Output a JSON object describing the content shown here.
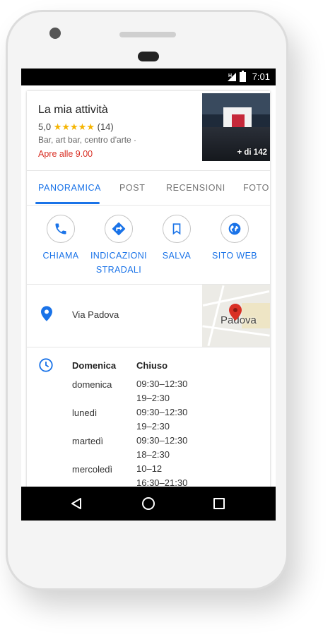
{
  "status_bar": {
    "time": "7:01",
    "network": "H"
  },
  "business": {
    "name": "La mia attività",
    "rating": "5,0",
    "stars": "★★★★★",
    "reviews_count": "(14)",
    "category": "Bar, art bar, centro d'arte  ·",
    "open_info": "Apre alle 9.00",
    "photos_more": "+ di 142"
  },
  "tabs": [
    "PANORAMICA",
    "POST",
    "RECENSIONI",
    "FOTO"
  ],
  "actions": {
    "call": "CHIAMA",
    "directions_line1": "INDICAZIONI",
    "directions_line2": "STRADALI",
    "save": "SALVA",
    "website": "SITO WEB"
  },
  "address": {
    "text": "Via Padova",
    "map_label": "Padova"
  },
  "hours": {
    "today_day": "Domenica",
    "today_status": "Chiuso",
    "rows": [
      {
        "day": "domenica",
        "slot1": "09:30–12:30",
        "slot2": "19–2:30"
      },
      {
        "day": "lunedì",
        "slot1": "09:30–12:30",
        "slot2": "19–2:30"
      },
      {
        "day": "martedì",
        "slot1": "09:30–12:30",
        "slot2": "18–2:30"
      },
      {
        "day": "mercoledì",
        "slot1": "10–12",
        "slot2": "16:30–21:30"
      }
    ]
  },
  "colors": {
    "accent": "#1a73e8",
    "star": "#f5b400",
    "closed": "#d93025"
  }
}
